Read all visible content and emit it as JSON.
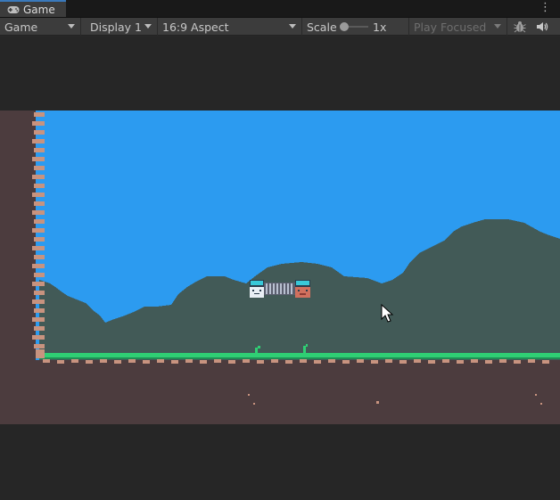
{
  "tab": {
    "label": "Game",
    "icon": "gamepad-icon"
  },
  "toolbar": {
    "mode": "Game",
    "display": "Display 1",
    "aspect": "16:9 Aspect",
    "scale_label": "Scale",
    "scale_value": "1x",
    "play_mode": "Play Focused"
  },
  "icons": [
    "gamepad-icon",
    "kebab-menu-icon",
    "bug-icon",
    "speaker-icon",
    "cursor-icon"
  ],
  "colors": {
    "sky": "#2c9bf0",
    "hills": "#425a57",
    "ground": "#4c3c3e",
    "grass": "#2fcf74",
    "editor_panel": "#3c3c3c",
    "tab_accent": "#3a79bb"
  }
}
